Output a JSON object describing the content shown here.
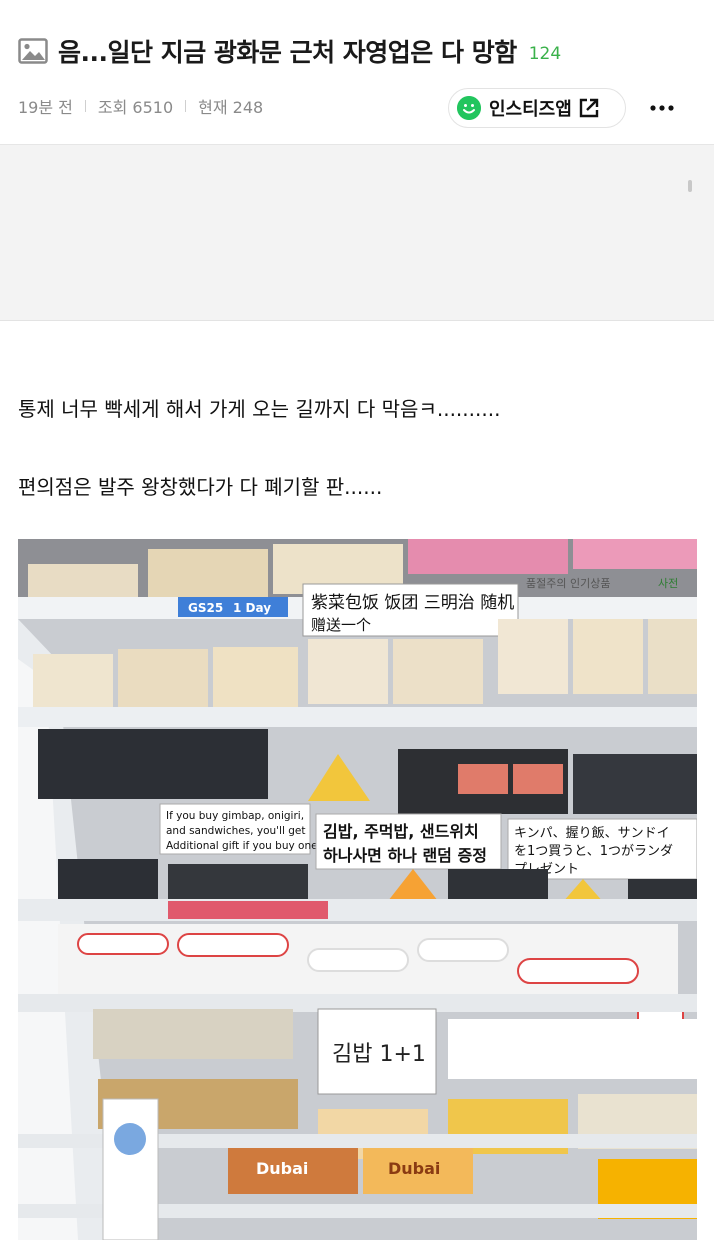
{
  "post": {
    "title": "음...일단 지금 광화문 근처 자영업은 다 망함",
    "comment_count": "124",
    "time_ago": "19분 전",
    "views": "조회 6510",
    "current": "현재 248",
    "app_button_label": "인스티즈앱"
  },
  "body": {
    "paragraphs": [
      "통제 너무 빡세게 해서 가게 오는 길까지 다 막음ㅋ..........",
      "편의점은 발주 왕창했다가 다 폐기할 판......"
    ]
  },
  "photo": {
    "signs": {
      "chinese": "紫菜包饭 饭团 三明治 随机",
      "chinese_line2": "赠送一个",
      "english_line1": "If you buy gimbap, onigiri,",
      "english_line2": "and sandwiches, you'll get",
      "english_line3": "Additional gift if you buy one",
      "korean_line1": "김밥, 주먹밥, 샌드위치",
      "korean_line2": "하나사면 하나 랜덤 증정",
      "japanese_line1": "キンパ、握り飯、サンドイ",
      "japanese_line2": "を1つ買うと、1つがランダ",
      "japanese_line3": "プレゼント",
      "handwritten": "김밥 1+1",
      "shelf_label_1": "GS25",
      "shelf_label_2": "1 Day",
      "top_right_tag": "품절주의 인기상품",
      "top_right_tag2": "사전",
      "dubai_1": "Dubai",
      "dubai_2": "Dubai"
    }
  },
  "colors": {
    "accent_green": "#3ab14a",
    "app_logo": "#22c55e"
  }
}
